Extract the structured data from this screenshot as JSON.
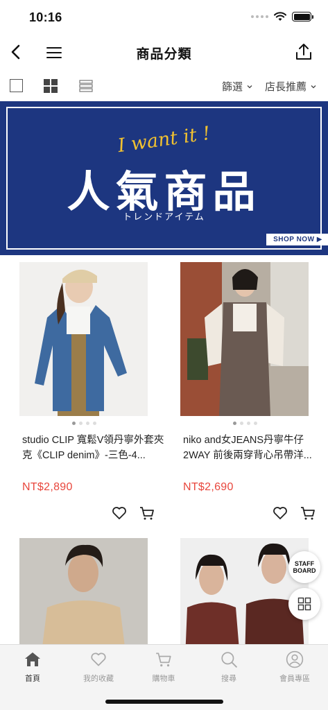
{
  "status": {
    "time": "10:16"
  },
  "nav": {
    "title": "商品分類"
  },
  "toolbar": {
    "filter_label": "篩選",
    "sort_label": "店長推薦"
  },
  "banner": {
    "script": "I want it !",
    "title": "人氣商品",
    "subtitle": "トレンドアイテム",
    "shop_now": "SHOP NOW ▶",
    "bg_color": "#1d3680"
  },
  "products": [
    {
      "name": "studio CLIP 寬鬆V領丹寧外套夾克《CLIP denim》-三色-4...",
      "price": "NT$2,890",
      "image": "model-denim-jacket-photo"
    },
    {
      "name": "niko and女JEANS丹寧牛仔2WAY 前後兩穿背心吊帶洋...",
      "price": "NT$2,690",
      "image": "model-denim-overall-dress-photo"
    },
    {
      "name": "",
      "price": "",
      "image": "model-beige-knit-sweater-photo"
    },
    {
      "name": "",
      "price": "",
      "image": "models-floral-sheer-dress-photo"
    }
  ],
  "floating": {
    "staff_board": "STAFF BOARD"
  },
  "tabs": [
    {
      "label": "首頁",
      "icon": "home-icon",
      "active": true
    },
    {
      "label": "我的收藏",
      "icon": "heart-icon",
      "active": false
    },
    {
      "label": "購物車",
      "icon": "cart-icon",
      "active": false
    },
    {
      "label": "搜尋",
      "icon": "search-icon",
      "active": false
    },
    {
      "label": "會員專區",
      "icon": "user-icon",
      "active": false
    }
  ],
  "colors": {
    "price": "#e8463c",
    "accent_yellow": "#f2c230"
  }
}
